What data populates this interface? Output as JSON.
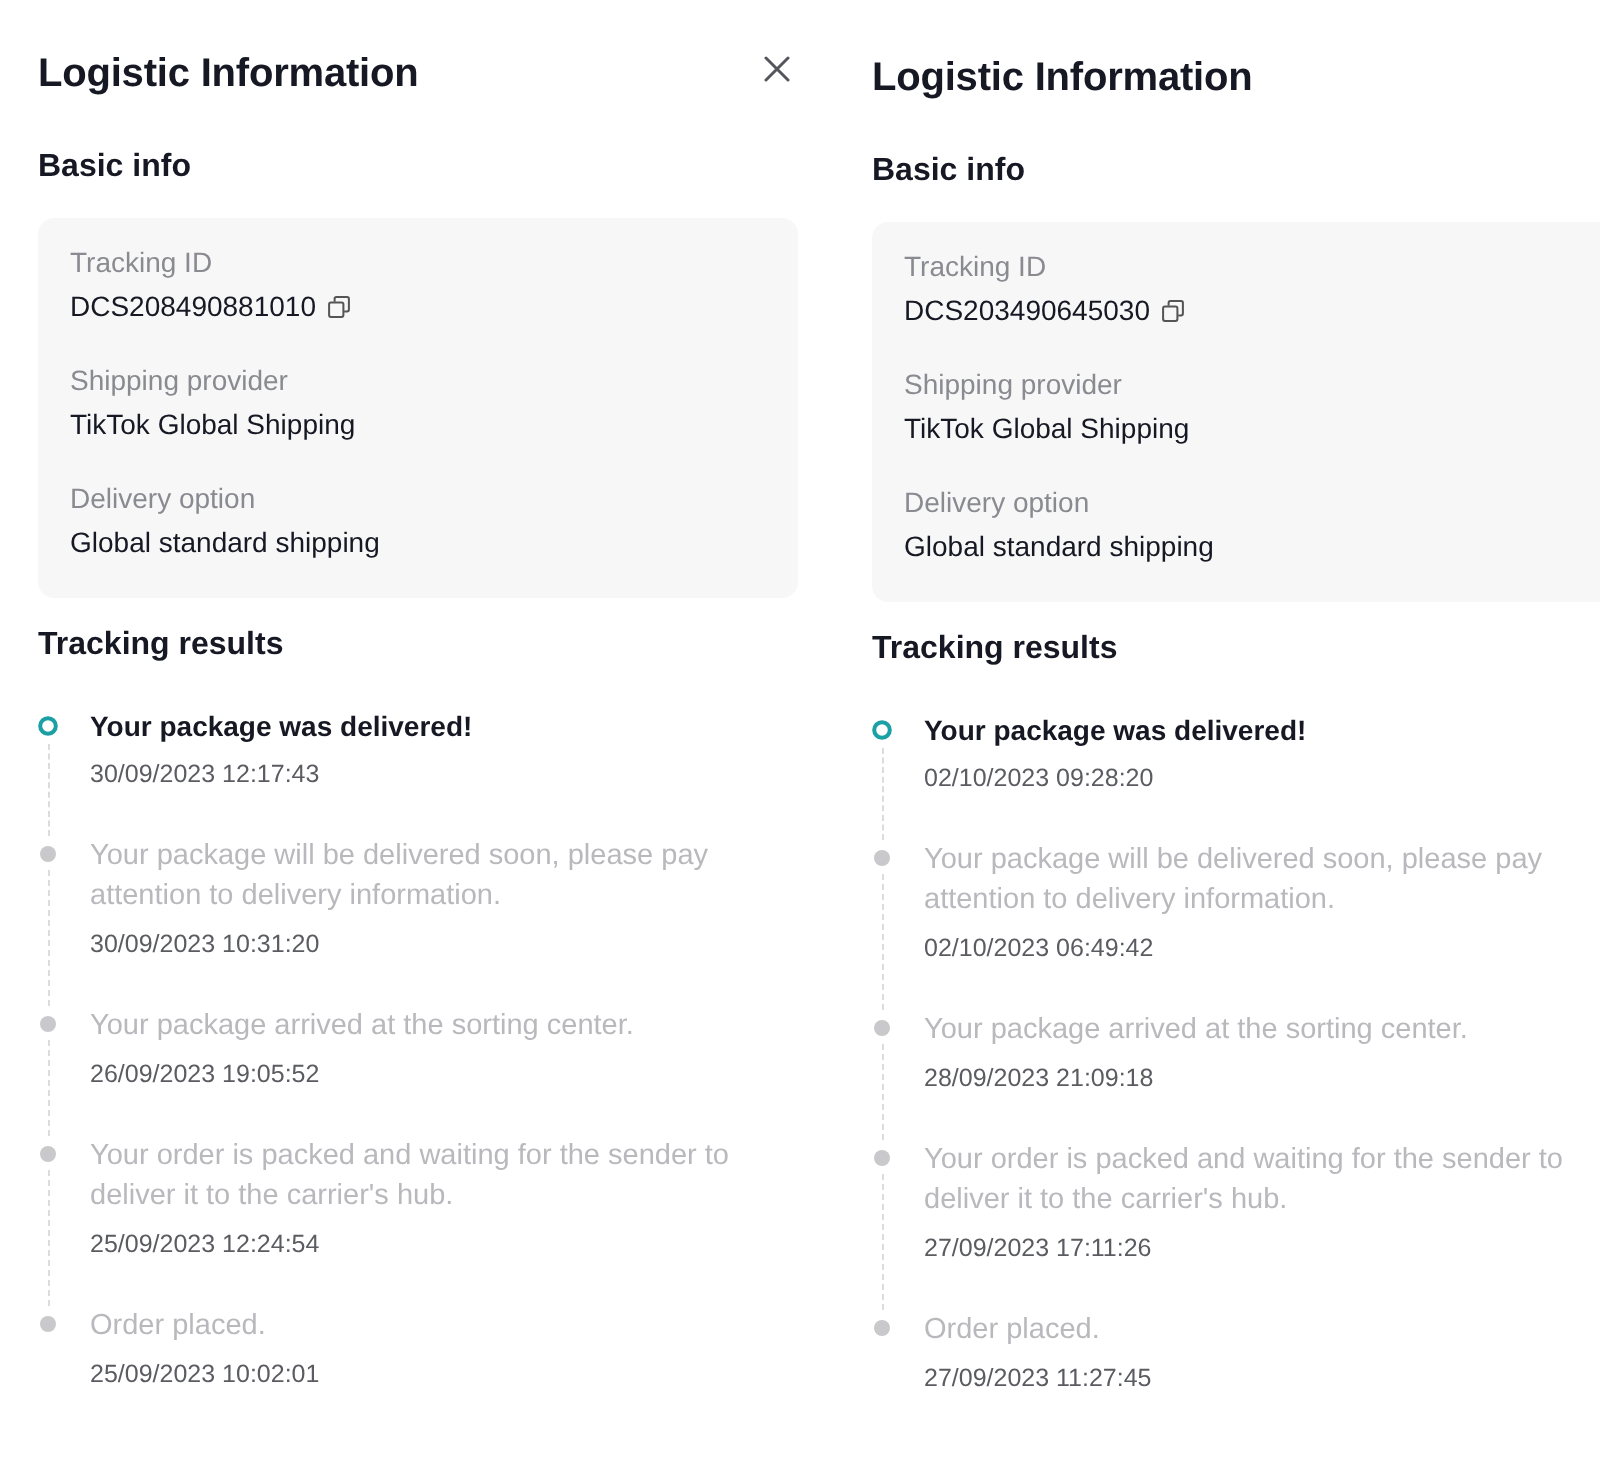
{
  "panels": [
    {
      "title": "Logistic Information",
      "close_button": true,
      "basic_info": {
        "heading": "Basic info",
        "fields": [
          {
            "label": "Tracking ID",
            "value": "DCS208490881010",
            "copyable": true
          },
          {
            "label": "Shipping provider",
            "value": "TikTok Global Shipping",
            "copyable": false
          },
          {
            "label": "Delivery option",
            "value": "Global standard shipping",
            "copyable": false
          }
        ]
      },
      "tracking": {
        "heading": "Tracking results",
        "events": [
          {
            "text": "Your package was delivered!",
            "time": "30/09/2023 12:17:43",
            "current": true
          },
          {
            "text": "Your package will be delivered soon, please pay attention to delivery information.",
            "time": "30/09/2023 10:31:20",
            "current": false
          },
          {
            "text": "Your package arrived at the sorting center.",
            "time": "26/09/2023 19:05:52",
            "current": false
          },
          {
            "text": "Your order is packed and waiting for the sender to deliver it to the carrier's hub.",
            "time": "25/09/2023 12:24:54",
            "current": false
          },
          {
            "text": "Order placed.",
            "time": "25/09/2023 10:02:01",
            "current": false
          }
        ]
      }
    },
    {
      "title": "Logistic Information",
      "close_button": false,
      "basic_info": {
        "heading": "Basic info",
        "fields": [
          {
            "label": "Tracking ID",
            "value": "DCS203490645030",
            "copyable": true
          },
          {
            "label": "Shipping provider",
            "value": "TikTok Global Shipping",
            "copyable": false
          },
          {
            "label": "Delivery option",
            "value": "Global standard shipping",
            "copyable": false
          }
        ]
      },
      "tracking": {
        "heading": "Tracking results",
        "events": [
          {
            "text": "Your package was delivered!",
            "time": "02/10/2023 09:28:20",
            "current": true
          },
          {
            "text": "Your package will be delivered soon, please pay attention to delivery information.",
            "time": "02/10/2023 06:49:42",
            "current": false
          },
          {
            "text": "Your package arrived at the sorting center.",
            "time": "28/09/2023 21:09:18",
            "current": false
          },
          {
            "text": "Your order is packed and waiting for the sender to deliver it to the carrier's hub.",
            "time": "27/09/2023 17:11:26",
            "current": false
          },
          {
            "text": "Order placed.",
            "time": "27/09/2023 11:27:45",
            "current": false
          }
        ]
      }
    }
  ]
}
